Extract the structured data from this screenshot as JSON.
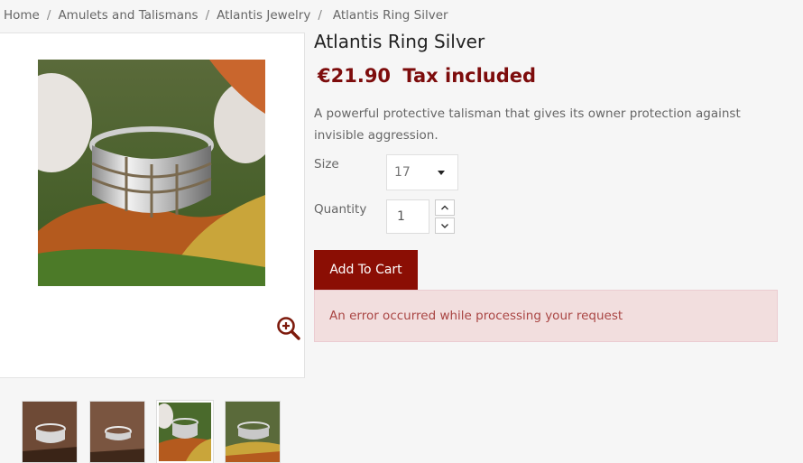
{
  "breadcrumb": {
    "items": [
      "Home",
      "Amulets and Talismans",
      "Atlantis Jewelry"
    ],
    "separator": "/",
    "current": "Atlantis Ring Silver"
  },
  "product": {
    "title": "Atlantis Ring Silver",
    "price": "€21.90",
    "tax_note": "Tax included",
    "description": "A powerful protective talisman that gives its owner protection against invisible aggression."
  },
  "options": {
    "size_label": "Size",
    "size_value": "17",
    "quantity_label": "Quantity",
    "quantity_value": "1"
  },
  "actions": {
    "add_to_cart": "Add To Cart"
  },
  "alert": {
    "message": "An error occurred while processing your request"
  },
  "gallery": {
    "thumbnail_count": 4,
    "selected_index": 2
  },
  "icons": {
    "zoom": "zoom-in-icon",
    "size_caret": "caret-down-icon",
    "qty_up": "chevron-up-icon",
    "qty_down": "chevron-down-icon"
  },
  "colors": {
    "accent": "#8b0e04",
    "price": "#7d0c0c",
    "alert_bg": "#f2dede",
    "alert_text": "#a94442"
  }
}
